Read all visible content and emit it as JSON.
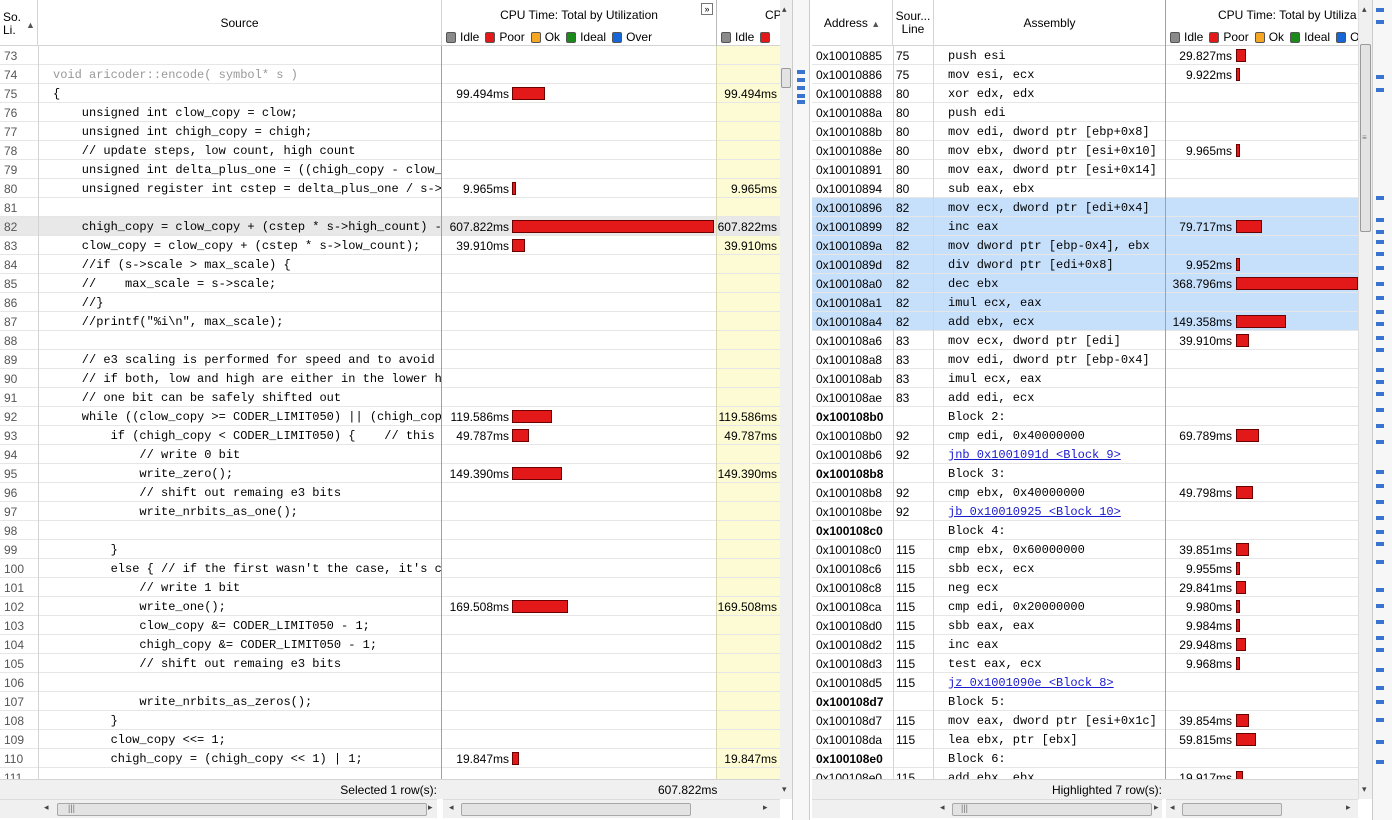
{
  "left_header": {
    "line_col": "So.\nLi.",
    "source_col": "Source",
    "cpu_col": "CPU Time: Total by Utilization",
    "cpu_col2": "CP"
  },
  "right_header": {
    "address_col": "Address",
    "source_line_col": "Sour...\nLine",
    "assembly_col": "Assembly",
    "cpu_col": "CPU Time: Total by Utiliza"
  },
  "legend": [
    {
      "label": "Idle",
      "color": "#8a8a8a"
    },
    {
      "label": "Poor",
      "color": "#e31818"
    },
    {
      "label": "Ok",
      "color": "#f5a623"
    },
    {
      "label": "Ideal",
      "color": "#1a8a1a"
    },
    {
      "label": "Over",
      "color": "#1566d6"
    }
  ],
  "source_rows": [
    {
      "line": "73",
      "code": "",
      "time": "",
      "bar": 0
    },
    {
      "line": "74",
      "code": "void aricoder::encode( symbol* s )",
      "time": "",
      "bar": 0,
      "grey": true
    },
    {
      "line": "75",
      "code": "{",
      "time": "99.494ms",
      "bar": 99.494
    },
    {
      "line": "76",
      "code": "    unsigned int clow_copy = clow;",
      "time": "",
      "bar": 0
    },
    {
      "line": "77",
      "code": "    unsigned int chigh_copy = chigh;",
      "time": "",
      "bar": 0
    },
    {
      "line": "78",
      "code": "    // update steps, low count, high count",
      "time": "",
      "bar": 0
    },
    {
      "line": "79",
      "code": "    unsigned int delta_plus_one = ((chigh_copy - clow_copy) + 1);",
      "time": "",
      "bar": 0
    },
    {
      "line": "80",
      "code": "    unsigned register int cstep = delta_plus_one / s->scale;",
      "time": "9.965ms",
      "bar": 9.965
    },
    {
      "line": "81",
      "code": "",
      "time": "",
      "bar": 0
    },
    {
      "line": "82",
      "code": "    chigh_copy = clow_copy + (cstep * s->high_count) - 1;",
      "time": "607.822ms",
      "bar": 607.822,
      "selected": true
    },
    {
      "line": "83",
      "code": "    clow_copy = clow_copy + (cstep * s->low_count);",
      "time": "39.910ms",
      "bar": 39.91
    },
    {
      "line": "84",
      "code": "    //if (s->scale > max_scale) {",
      "time": "",
      "bar": 0
    },
    {
      "line": "85",
      "code": "    //    max_scale = s->scale;",
      "time": "",
      "bar": 0
    },
    {
      "line": "86",
      "code": "    //}",
      "time": "",
      "bar": 0
    },
    {
      "line": "87",
      "code": "    //printf(\"%i\\n\", max_scale);",
      "time": "",
      "bar": 0
    },
    {
      "line": "88",
      "code": "",
      "time": "",
      "bar": 0
    },
    {
      "line": "89",
      "code": "    // e3 scaling is performed for speed and to avoid underflows",
      "time": "",
      "bar": 0
    },
    {
      "line": "90",
      "code": "    // if both, low and high are either in the lower half or in the higher half",
      "time": "",
      "bar": 0
    },
    {
      "line": "91",
      "code": "    // one bit can be safely shifted out",
      "time": "",
      "bar": 0
    },
    {
      "line": "92",
      "code": "    while ((clow_copy >= CODER_LIMIT050) || (chigh_copy < CODER_LIMIT050)) {",
      "time": "119.586ms",
      "bar": 119.586
    },
    {
      "line": "93",
      "code": "        if (chigh_copy < CODER_LIMIT050) {    // this means both",
      "time": "49.787ms",
      "bar": 49.787
    },
    {
      "line": "94",
      "code": "            // write 0 bit",
      "time": "",
      "bar": 0
    },
    {
      "line": "95",
      "code": "            write_zero();",
      "time": "149.390ms",
      "bar": 149.39
    },
    {
      "line": "96",
      "code": "            // shift out remaing e3 bits",
      "time": "",
      "bar": 0
    },
    {
      "line": "97",
      "code": "            write_nrbits_as_one();",
      "time": "",
      "bar": 0
    },
    {
      "line": "98",
      "code": "",
      "time": "",
      "bar": 0
    },
    {
      "line": "99",
      "code": "        }",
      "time": "",
      "bar": 0
    },
    {
      "line": "100",
      "code": "        else { // if the first wasn't the case, it's clow >= CODER_LIMIT050",
      "time": "",
      "bar": 0
    },
    {
      "line": "101",
      "code": "            // write 1 bit",
      "time": "",
      "bar": 0
    },
    {
      "line": "102",
      "code": "            write_one();",
      "time": "169.508ms",
      "bar": 169.508
    },
    {
      "line": "103",
      "code": "            clow_copy &= CODER_LIMIT050 - 1;",
      "time": "",
      "bar": 0
    },
    {
      "line": "104",
      "code": "            chigh_copy &= CODER_LIMIT050 - 1;",
      "time": "",
      "bar": 0
    },
    {
      "line": "105",
      "code": "            // shift out remaing e3 bits",
      "time": "",
      "bar": 0
    },
    {
      "line": "106",
      "code": "",
      "time": "",
      "bar": 0
    },
    {
      "line": "107",
      "code": "            write_nrbits_as_zeros();",
      "time": "",
      "bar": 0
    },
    {
      "line": "108",
      "code": "        }",
      "time": "",
      "bar": 0
    },
    {
      "line": "109",
      "code": "        clow_copy <<= 1;",
      "time": "",
      "bar": 0
    },
    {
      "line": "110",
      "code": "        chigh_copy = (chigh_copy << 1) | 1;",
      "time": "19.847ms",
      "bar": 19.847
    },
    {
      "line": "111",
      "code": "",
      "time": "",
      "bar": 0
    }
  ],
  "asm_rows": [
    {
      "addr": "0x10010885",
      "line": "75",
      "asm": "push esi",
      "time": "29.827ms",
      "bar": 29.827
    },
    {
      "addr": "0x10010886",
      "line": "75",
      "asm": "mov esi, ecx",
      "time": "9.922ms",
      "bar": 9.922
    },
    {
      "addr": "0x10010888",
      "line": "80",
      "asm": "xor edx, edx",
      "time": "",
      "bar": 0
    },
    {
      "addr": "0x1001088a",
      "line": "80",
      "asm": "push edi",
      "time": "",
      "bar": 0
    },
    {
      "addr": "0x1001088b",
      "line": "80",
      "asm": "mov edi, dword ptr [ebp+0x8]",
      "time": "",
      "bar": 0
    },
    {
      "addr": "0x1001088e",
      "line": "80",
      "asm": "mov ebx, dword ptr [esi+0x10]",
      "time": "9.965ms",
      "bar": 9.965
    },
    {
      "addr": "0x10010891",
      "line": "80",
      "asm": "mov eax, dword ptr [esi+0x14]",
      "time": "",
      "bar": 0
    },
    {
      "addr": "0x10010894",
      "line": "80",
      "asm": "sub eax, ebx",
      "time": "",
      "bar": 0
    },
    {
      "addr": "0x10010896",
      "line": "82",
      "asm": "mov ecx, dword ptr [edi+0x4]",
      "time": "",
      "bar": 0,
      "hl": true
    },
    {
      "addr": "0x10010899",
      "line": "82",
      "asm": "inc eax",
      "time": "79.717ms",
      "bar": 79.717,
      "hl": true
    },
    {
      "addr": "0x1001089a",
      "line": "82",
      "asm": "mov dword ptr [ebp-0x4], ebx",
      "time": "",
      "bar": 0,
      "hl": true
    },
    {
      "addr": "0x1001089d",
      "line": "82",
      "asm": "div dword ptr [edi+0x8]",
      "time": "9.952ms",
      "bar": 9.952,
      "hl": true
    },
    {
      "addr": "0x100108a0",
      "line": "82",
      "asm": "dec ebx",
      "time": "368.796ms",
      "bar": 368.796,
      "hl": true
    },
    {
      "addr": "0x100108a1",
      "line": "82",
      "asm": "imul ecx, eax",
      "time": "",
      "bar": 0,
      "hl": true
    },
    {
      "addr": "0x100108a4",
      "line": "82",
      "asm": "add ebx, ecx",
      "time": "149.358ms",
      "bar": 149.358,
      "hl": true
    },
    {
      "addr": "0x100108a6",
      "line": "83",
      "asm": "mov ecx, dword ptr [edi]",
      "time": "39.910ms",
      "bar": 39.91
    },
    {
      "addr": "0x100108a8",
      "line": "83",
      "asm": "mov edi, dword ptr [ebp-0x4]",
      "time": "",
      "bar": 0
    },
    {
      "addr": "0x100108ab",
      "line": "83",
      "asm": "imul ecx, eax",
      "time": "",
      "bar": 0
    },
    {
      "addr": "0x100108ae",
      "line": "83",
      "asm": "add edi, ecx",
      "time": "",
      "bar": 0
    },
    {
      "addr": "0x100108b0",
      "line": "",
      "asm": "Block 2:",
      "time": "",
      "bar": 0,
      "block": true
    },
    {
      "addr": "0x100108b0",
      "line": "92",
      "asm": "cmp edi, 0x40000000",
      "time": "69.789ms",
      "bar": 69.789
    },
    {
      "addr": "0x100108b6",
      "line": "92",
      "asm": "jnb 0x1001091d <Block 9>",
      "time": "",
      "bar": 0,
      "link": true
    },
    {
      "addr": "0x100108b8",
      "line": "",
      "asm": "Block 3:",
      "time": "",
      "bar": 0,
      "block": true
    },
    {
      "addr": "0x100108b8",
      "line": "92",
      "asm": "cmp ebx, 0x40000000",
      "time": "49.798ms",
      "bar": 49.798
    },
    {
      "addr": "0x100108be",
      "line": "92",
      "asm": "jb 0x10010925 <Block 10>",
      "time": "",
      "bar": 0,
      "link": true
    },
    {
      "addr": "0x100108c0",
      "line": "",
      "asm": "Block 4:",
      "time": "",
      "bar": 0,
      "block": true
    },
    {
      "addr": "0x100108c0",
      "line": "115",
      "asm": "cmp ebx, 0x60000000",
      "time": "39.851ms",
      "bar": 39.851
    },
    {
      "addr": "0x100108c6",
      "line": "115",
      "asm": "sbb ecx, ecx",
      "time": "9.955ms",
      "bar": 9.955
    },
    {
      "addr": "0x100108c8",
      "line": "115",
      "asm": "neg ecx",
      "time": "29.841ms",
      "bar": 29.841
    },
    {
      "addr": "0x100108ca",
      "line": "115",
      "asm": "cmp edi, 0x20000000",
      "time": "9.980ms",
      "bar": 9.98
    },
    {
      "addr": "0x100108d0",
      "line": "115",
      "asm": "sbb eax, eax",
      "time": "9.984ms",
      "bar": 9.984
    },
    {
      "addr": "0x100108d2",
      "line": "115",
      "asm": "inc eax",
      "time": "29.948ms",
      "bar": 29.948
    },
    {
      "addr": "0x100108d3",
      "line": "115",
      "asm": "test eax, ecx",
      "time": "9.968ms",
      "bar": 9.968
    },
    {
      "addr": "0x100108d5",
      "line": "115",
      "asm": "jz 0x1001090e <Block 8>",
      "time": "",
      "bar": 0,
      "link": true
    },
    {
      "addr": "0x100108d7",
      "line": "",
      "asm": "Block 5:",
      "time": "",
      "bar": 0,
      "block": true
    },
    {
      "addr": "0x100108d7",
      "line": "115",
      "asm": "mov eax, dword ptr [esi+0x1c]",
      "time": "39.854ms",
      "bar": 39.854
    },
    {
      "addr": "0x100108da",
      "line": "115",
      "asm": "lea ebx, ptr [ebx]",
      "time": "59.815ms",
      "bar": 59.815
    },
    {
      "addr": "0x100108e0",
      "line": "",
      "asm": "Block 6:",
      "time": "",
      "bar": 0,
      "block": true
    },
    {
      "addr": "0x100108e0",
      "line": "115",
      "asm": "add ebx, ebx",
      "time": "19.917ms",
      "bar": 19.917
    }
  ],
  "left_footer": {
    "status": "Selected 1 row(s):",
    "total": "607.822ms"
  },
  "right_footer": {
    "status": "Highlighted 7 row(s):"
  }
}
